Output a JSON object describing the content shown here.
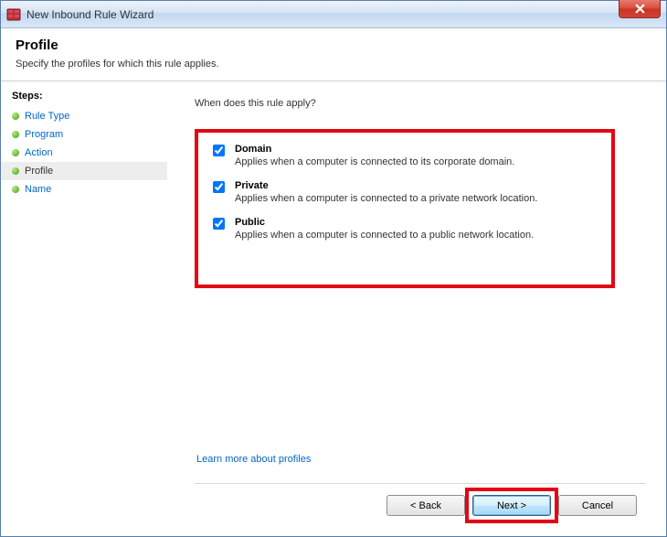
{
  "window": {
    "title": "New Inbound Rule Wizard"
  },
  "header": {
    "title": "Profile",
    "subtitle": "Specify the profiles for which this rule applies."
  },
  "steps": {
    "heading": "Steps:",
    "items": [
      {
        "label": "Rule Type",
        "active": false
      },
      {
        "label": "Program",
        "active": false
      },
      {
        "label": "Action",
        "active": false
      },
      {
        "label": "Profile",
        "active": true
      },
      {
        "label": "Name",
        "active": false
      }
    ]
  },
  "content": {
    "question": "When does this rule apply?",
    "profiles": [
      {
        "title": "Domain",
        "desc": "Applies when a computer is connected to its corporate domain.",
        "checked": true
      },
      {
        "title": "Private",
        "desc": "Applies when a computer is connected to a private network location.",
        "checked": true
      },
      {
        "title": "Public",
        "desc": "Applies when a computer is connected to a public network location.",
        "checked": true
      }
    ],
    "learn_link": "Learn more about profiles"
  },
  "buttons": {
    "back": "< Back",
    "next": "Next >",
    "cancel": "Cancel"
  }
}
